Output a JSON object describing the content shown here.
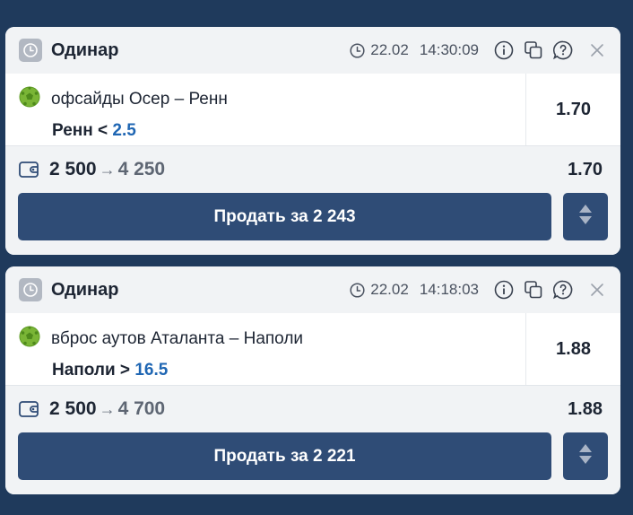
{
  "colors": {
    "background": "#1f3a5c",
    "button": "#2f4c76",
    "accent_value": "#1f66b3",
    "ball": "#7ab536"
  },
  "bets": [
    {
      "title": "Одинар",
      "date": "22.02",
      "time": "14:30:09",
      "event": "офсайды Осер – Ренн",
      "outcome_label": "Ренн <",
      "outcome_value": "2.5",
      "odd": "1.70",
      "stake": "2 500",
      "arrow": "→",
      "payout": "4 250",
      "sum_odd": "1.70",
      "sell_label": "Продать за 2 243"
    },
    {
      "title": "Одинар",
      "date": "22.02",
      "time": "14:18:03",
      "event": "вброс аутов Аталанта – Наполи",
      "outcome_label": "Наполи >",
      "outcome_value": "16.5",
      "odd": "1.88",
      "stake": "2 500",
      "arrow": "→",
      "payout": "4 700",
      "sum_odd": "1.88",
      "sell_label": "Продать за 2 221"
    }
  ],
  "icons": [
    "clock-icon",
    "time-icon",
    "info-icon",
    "copy-icon",
    "help-icon",
    "close-icon",
    "football-icon",
    "wallet-icon",
    "sort-icon"
  ]
}
